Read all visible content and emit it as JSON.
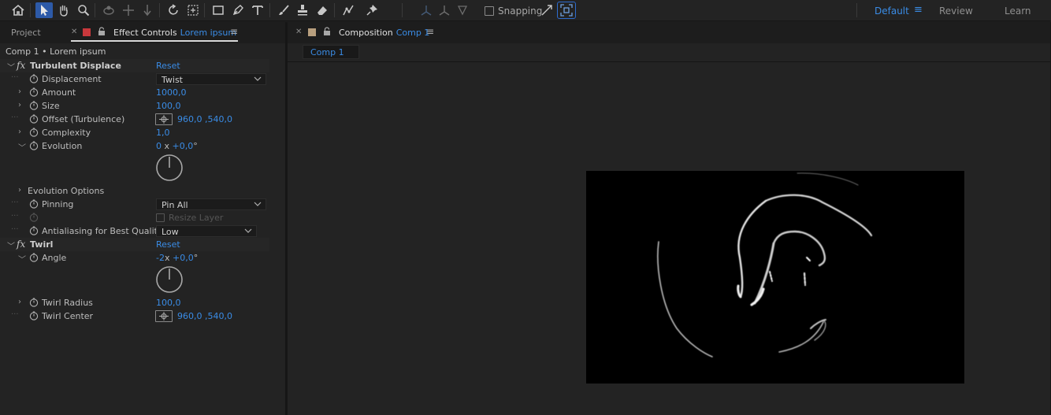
{
  "toolbar": {
    "tools": [
      "home-icon",
      "selection-tool-icon",
      "hand-tool-icon",
      "zoom-tool-icon",
      "orbit-camera-icon",
      "pan-camera-icon",
      "dolly-camera-icon",
      "rotation-tool-icon",
      "pan-behind-icon",
      "rectangle-tool-icon",
      "pen-tool-icon",
      "type-tool-icon",
      "brush-tool-icon",
      "clone-stamp-icon",
      "eraser-icon",
      "roto-brush-icon",
      "puppet-pin-icon"
    ],
    "snapping_label": "Snapping",
    "snapping_checked": false
  },
  "workspaces": {
    "active": "Default",
    "items": [
      "Default",
      "Review",
      "Learn"
    ],
    "menu_icon": "hamburger-icon"
  },
  "left_panel": {
    "tab_project": "Project",
    "tab_effect_controls": "Effect Controls",
    "tab_effect_controls_layer": "Lorem ipsum",
    "breadcrumb": "Comp 1 • Lorem ipsum",
    "effects": [
      {
        "name": "Turbulent Displace",
        "reset_label": "Reset",
        "properties": [
          {
            "name": "Displacement",
            "type": "dropdown",
            "value": "Twist"
          },
          {
            "name": "Amount",
            "value": "1000,0"
          },
          {
            "name": "Size",
            "value": "100,0"
          },
          {
            "name": "Offset (Turbulence)",
            "type": "point",
            "value": "960,0 ,540,0"
          },
          {
            "name": "Complexity",
            "value": "1,0"
          },
          {
            "name": "Evolution",
            "type": "angle",
            "revolutions": "0",
            "x_label": "x",
            "value": "+0,0",
            "unit": "°",
            "dial_angle_deg": 0
          },
          {
            "name": "Evolution Options"
          },
          {
            "name": "Pinning",
            "type": "dropdown",
            "value": "Pin All"
          },
          {
            "name": "Resize Layer",
            "type": "checkbox",
            "checked": false,
            "disabled": true
          },
          {
            "name": "Antialiasing for Best Quality",
            "type": "dropdown",
            "value": "Low"
          }
        ]
      },
      {
        "name": "Twirl",
        "reset_label": "Reset",
        "properties": [
          {
            "name": "Angle",
            "type": "angle",
            "revolutions": "-2",
            "x_label": "x",
            "value": "+0,0",
            "unit": "°",
            "dial_angle_deg": 0
          },
          {
            "name": "Twirl Radius",
            "value": "100,0"
          },
          {
            "name": "Twirl Center",
            "type": "point",
            "value": "960,0 ,540,0"
          }
        ]
      }
    ]
  },
  "composition_panel": {
    "tab_label": "Composition",
    "tab_comp_name": "Comp 1",
    "viewer_chip": "Comp 1",
    "canvas_background": "#000000"
  },
  "colors": {
    "accent": "#3a8ce6",
    "panel_bg": "#232323",
    "label_red": "#c8383c",
    "label_tan": "#b89f7e"
  }
}
